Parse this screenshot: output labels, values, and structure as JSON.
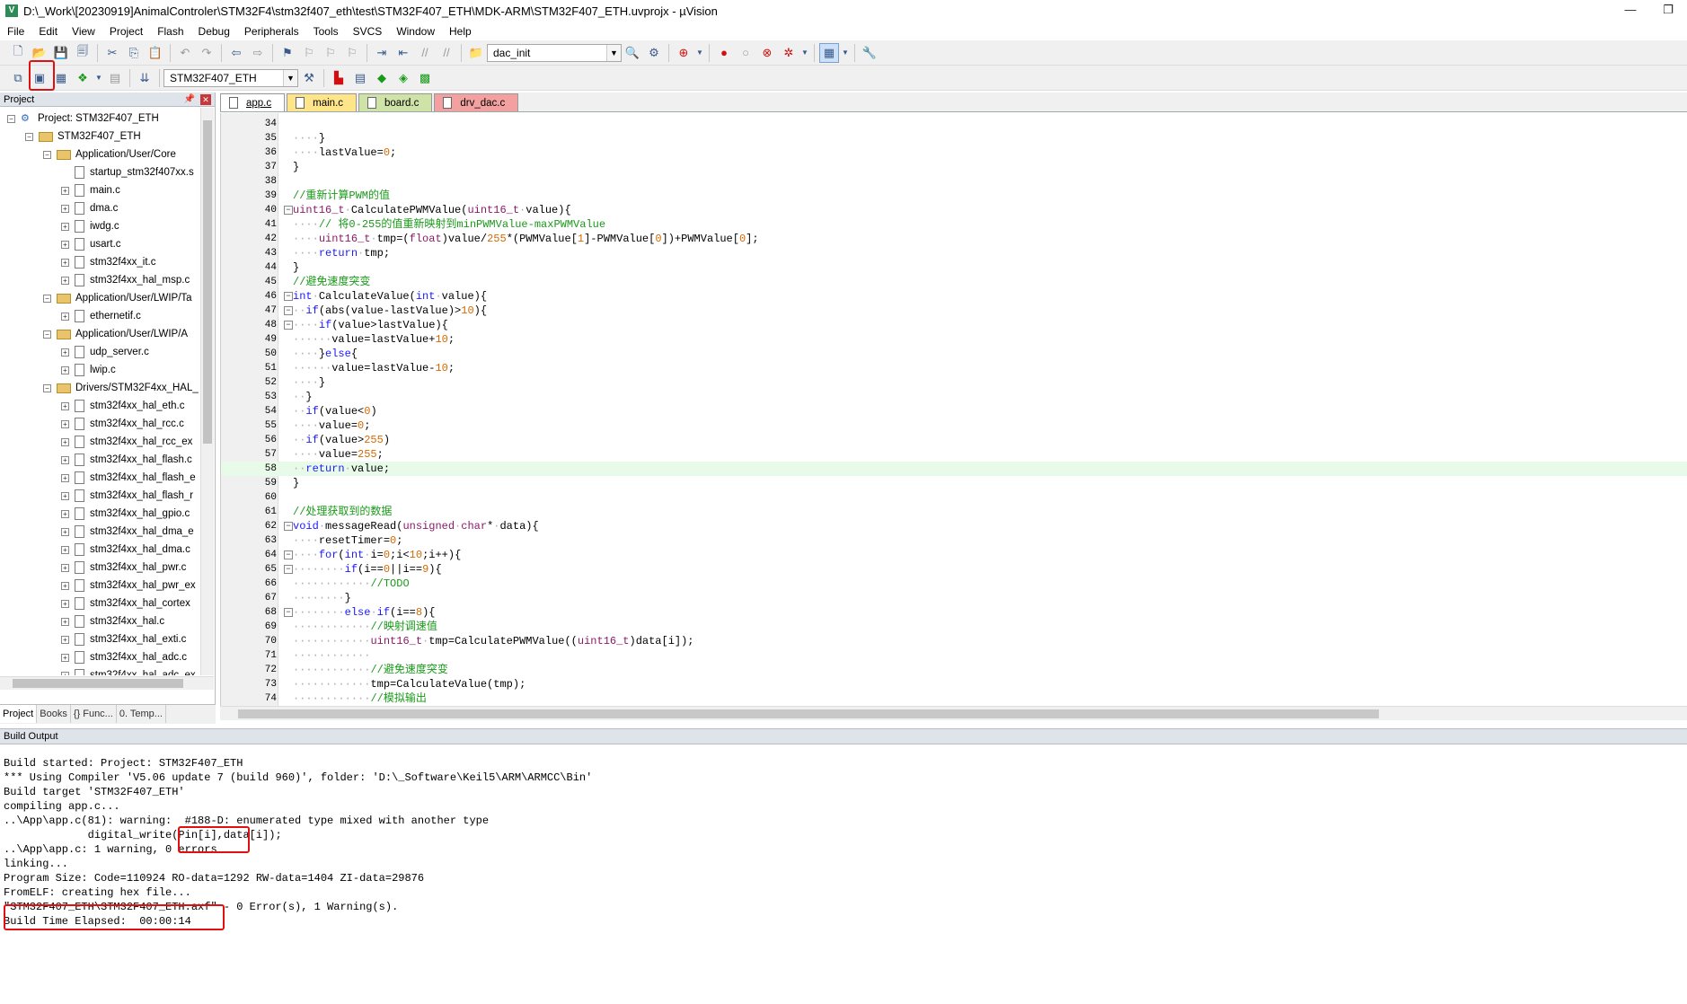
{
  "window": {
    "title": "D:\\_Work\\[20230919]AnimalControler\\STM32F4\\stm32f407_eth\\test\\STM32F407_ETH\\MDK-ARM\\STM32F407_ETH.uvprojx - µVision",
    "minimize": "—",
    "restore": "❐"
  },
  "menu": [
    "File",
    "Edit",
    "View",
    "Project",
    "Flash",
    "Debug",
    "Peripherals",
    "Tools",
    "SVCS",
    "Window",
    "Help"
  ],
  "toolbar": {
    "function_combo": "dac_init",
    "target_combo": "STM32F407_ETH"
  },
  "project_panel": {
    "header": "Project",
    "tree": [
      {
        "label": "Project: STM32F407_ETH",
        "level": 0,
        "kind": "project",
        "exp": "−"
      },
      {
        "label": "STM32F407_ETH",
        "level": 1,
        "kind": "target",
        "exp": "−"
      },
      {
        "label": "Application/User/Core",
        "level": 2,
        "kind": "folder",
        "exp": "−"
      },
      {
        "label": "startup_stm32f407xx.s",
        "level": 3,
        "kind": "file",
        "exp": ""
      },
      {
        "label": "main.c",
        "level": 3,
        "kind": "file",
        "exp": "+"
      },
      {
        "label": "dma.c",
        "level": 3,
        "kind": "file",
        "exp": "+"
      },
      {
        "label": "iwdg.c",
        "level": 3,
        "kind": "file",
        "exp": "+"
      },
      {
        "label": "usart.c",
        "level": 3,
        "kind": "file",
        "exp": "+"
      },
      {
        "label": "stm32f4xx_it.c",
        "level": 3,
        "kind": "file",
        "exp": "+"
      },
      {
        "label": "stm32f4xx_hal_msp.c",
        "level": 3,
        "kind": "file",
        "exp": "+"
      },
      {
        "label": "Application/User/LWIP/Ta",
        "level": 2,
        "kind": "folder",
        "exp": "−"
      },
      {
        "label": "ethernetif.c",
        "level": 3,
        "kind": "file",
        "exp": "+"
      },
      {
        "label": "Application/User/LWIP/A",
        "level": 2,
        "kind": "folder",
        "exp": "−"
      },
      {
        "label": "udp_server.c",
        "level": 3,
        "kind": "file",
        "exp": "+"
      },
      {
        "label": "lwip.c",
        "level": 3,
        "kind": "file",
        "exp": "+"
      },
      {
        "label": "Drivers/STM32F4xx_HAL_",
        "level": 2,
        "kind": "folder",
        "exp": "−"
      },
      {
        "label": "stm32f4xx_hal_eth.c",
        "level": 3,
        "kind": "file",
        "exp": "+"
      },
      {
        "label": "stm32f4xx_hal_rcc.c",
        "level": 3,
        "kind": "file",
        "exp": "+"
      },
      {
        "label": "stm32f4xx_hal_rcc_ex",
        "level": 3,
        "kind": "file",
        "exp": "+"
      },
      {
        "label": "stm32f4xx_hal_flash.c",
        "level": 3,
        "kind": "file",
        "exp": "+"
      },
      {
        "label": "stm32f4xx_hal_flash_e",
        "level": 3,
        "kind": "file",
        "exp": "+"
      },
      {
        "label": "stm32f4xx_hal_flash_r",
        "level": 3,
        "kind": "file",
        "exp": "+"
      },
      {
        "label": "stm32f4xx_hal_gpio.c",
        "level": 3,
        "kind": "file",
        "exp": "+"
      },
      {
        "label": "stm32f4xx_hal_dma_e",
        "level": 3,
        "kind": "file",
        "exp": "+"
      },
      {
        "label": "stm32f4xx_hal_dma.c",
        "level": 3,
        "kind": "file",
        "exp": "+"
      },
      {
        "label": "stm32f4xx_hal_pwr.c",
        "level": 3,
        "kind": "file",
        "exp": "+"
      },
      {
        "label": "stm32f4xx_hal_pwr_ex",
        "level": 3,
        "kind": "file",
        "exp": "+"
      },
      {
        "label": "stm32f4xx_hal_cortex",
        "level": 3,
        "kind": "file",
        "exp": "+"
      },
      {
        "label": "stm32f4xx_hal.c",
        "level": 3,
        "kind": "file",
        "exp": "+"
      },
      {
        "label": "stm32f4xx_hal_exti.c",
        "level": 3,
        "kind": "file",
        "exp": "+"
      },
      {
        "label": "stm32f4xx_hal_adc.c",
        "level": 3,
        "kind": "file",
        "exp": "+"
      },
      {
        "label": "stm32f4xx_hal_adc_ex",
        "level": 3,
        "kind": "file",
        "exp": "+"
      }
    ],
    "tabs": [
      "Project",
      "Books",
      "{} Func...",
      "0. Temp..."
    ]
  },
  "editor_tabs": [
    {
      "label": "app.c",
      "style": "active"
    },
    {
      "label": "main.c",
      "style": "yl"
    },
    {
      "label": "board.c",
      "style": "gn"
    },
    {
      "label": "drv_dac.c",
      "style": "rd"
    }
  ],
  "code": {
    "current_line": "58",
    "lines": [
      {
        "n": "34",
        "fold": "",
        "t": ""
      },
      {
        "n": "35",
        "fold": "",
        "t": "····}"
      },
      {
        "n": "36",
        "fold": "",
        "t": "····lastValue=0;"
      },
      {
        "n": "37",
        "fold": "",
        "t": "}"
      },
      {
        "n": "38",
        "fold": "",
        "t": ""
      },
      {
        "n": "39",
        "fold": "",
        "t": "//重新计算PWM的值"
      },
      {
        "n": "40",
        "fold": "−",
        "t": "uint16_t·CalculatePWMValue(uint16_t·value){"
      },
      {
        "n": "41",
        "fold": "",
        "t": "····//·将0-255的值重新映射到minPWMValue-maxPWMValue"
      },
      {
        "n": "42",
        "fold": "",
        "t": "····uint16_t·tmp=(float)value/255*(PWMValue[1]-PWMValue[0])+PWMValue[0];"
      },
      {
        "n": "43",
        "fold": "",
        "t": "····return·tmp;"
      },
      {
        "n": "44",
        "fold": "",
        "t": "}"
      },
      {
        "n": "45",
        "fold": "",
        "t": "//避免速度突变"
      },
      {
        "n": "46",
        "fold": "−",
        "t": "int·CalculateValue(int·value){"
      },
      {
        "n": "47",
        "fold": "−",
        "t": "··if(abs(value-lastValue)>10){"
      },
      {
        "n": "48",
        "fold": "−",
        "t": "····if(value>lastValue){"
      },
      {
        "n": "49",
        "fold": "",
        "t": "······value=lastValue+10;"
      },
      {
        "n": "50",
        "fold": "",
        "t": "····}else{"
      },
      {
        "n": "51",
        "fold": "",
        "t": "······value=lastValue-10;"
      },
      {
        "n": "52",
        "fold": "",
        "t": "····}"
      },
      {
        "n": "53",
        "fold": "",
        "t": "··}"
      },
      {
        "n": "54",
        "fold": "",
        "t": "··if(value<0)"
      },
      {
        "n": "55",
        "fold": "",
        "t": "····value=0;"
      },
      {
        "n": "56",
        "fold": "",
        "t": "··if(value>255)"
      },
      {
        "n": "57",
        "fold": "",
        "t": "····value=255;"
      },
      {
        "n": "58",
        "fold": "",
        "t": "··return·value;"
      },
      {
        "n": "59",
        "fold": "",
        "t": "}"
      },
      {
        "n": "60",
        "fold": "",
        "t": ""
      },
      {
        "n": "61",
        "fold": "",
        "t": "//处理获取到的数据"
      },
      {
        "n": "62",
        "fold": "−",
        "t": "void·messageRead(unsigned·char*·data){"
      },
      {
        "n": "63",
        "fold": "",
        "t": "····resetTimer=0;"
      },
      {
        "n": "64",
        "fold": "−",
        "t": "····for(int·i=0;i<10;i++){"
      },
      {
        "n": "65",
        "fold": "−",
        "t": "········if(i==0||i==9){"
      },
      {
        "n": "66",
        "fold": "",
        "t": "············//TODO"
      },
      {
        "n": "67",
        "fold": "",
        "t": "········}"
      },
      {
        "n": "68",
        "fold": "−",
        "t": "········else·if(i==8){"
      },
      {
        "n": "69",
        "fold": "",
        "t": "············//映射调速值"
      },
      {
        "n": "70",
        "fold": "",
        "t": "············uint16_t·tmp=CalculatePWMValue((uint16_t)data[i]);"
      },
      {
        "n": "71",
        "fold": "",
        "t": "············"
      },
      {
        "n": "72",
        "fold": "",
        "t": "············//避免速度突变"
      },
      {
        "n": "73",
        "fold": "",
        "t": "············tmp=CalculateValue(tmp);"
      },
      {
        "n": "74",
        "fold": "",
        "t": "············//模拟输出"
      }
    ]
  },
  "build_output": {
    "header": "Build Output",
    "lines": [
      "Build started: Project: STM32F407_ETH",
      "*** Using Compiler 'V5.06 update 7 (build 960)', folder: 'D:\\_Software\\Keil5\\ARM\\ARMCC\\Bin'",
      "Build target 'STM32F407_ETH'",
      "compiling app.c...",
      "..\\App\\app.c(81): warning:  #188-D: enumerated type mixed with another type",
      "             digital_write(Pin[i],data[i]);",
      "..\\App\\app.c: 1 warning, 0 errors",
      "linking...",
      "Program Size: Code=110924 RO-data=1292 RW-data=1404 ZI-data=29876",
      "FromELF: creating hex file...",
      "\"STM32F407_ETH\\STM32F407_ETH.axf\" - 0 Error(s), 1 Warning(s).",
      "Build Time Elapsed:  00:00:14"
    ]
  },
  "colors": {
    "highlight": "#e01010",
    "keyword": "#1a1aff",
    "type": "#8b1a6a",
    "comment": "#1a9a1a",
    "number": "#d46a00"
  }
}
